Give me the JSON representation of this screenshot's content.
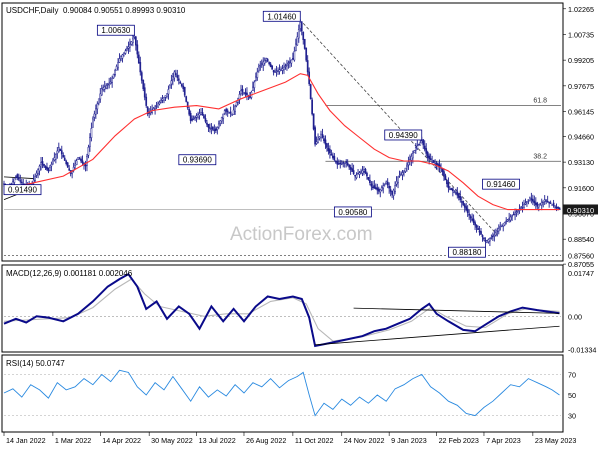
{
  "header": {
    "symbol": "USDCHF,Daily",
    "ohlc": "0.90084 0.90551 0.89993 0.90310"
  },
  "watermark": "ActionForex.com",
  "colors": {
    "candles": "#1f1f8f",
    "ma": "#ff3030",
    "macd": "#0a0a8a",
    "signal": "#b8b8b8",
    "rsi": "#2a8ae0",
    "box_border": "#000080",
    "price_marker_bg": "#1a1a1a",
    "fib": "#707070"
  },
  "chart_data": [
    {
      "type": "candlestick",
      "title": "USDCHF,Daily",
      "ylim": [
        0.873,
        1.0255
      ],
      "y_ticks": [
        "1.02265",
        "1.00735",
        "0.99205",
        "0.97675",
        "0.96145",
        "0.94660",
        "0.93130",
        "0.91600",
        "0.90070",
        "0.88540",
        "0.87055"
      ],
      "x_ticks": [
        "14 Jan 2022",
        "1 Mar 2022",
        "14 Apr 2022",
        "30 May 2022",
        "13 Jul 2022",
        "26 Aug 2022",
        "11 Oct 2022",
        "24 Nov 2022",
        "9 Jan 2023",
        "22 Feb 2023",
        "7 Apr 2023",
        "23 May 2023"
      ],
      "x_tick_index": [
        0,
        33,
        65,
        98,
        130,
        162,
        195,
        228,
        260,
        292,
        324,
        357
      ],
      "current_price": "0.90310",
      "price_series": [
        [
          0,
          0.9185
        ],
        [
          3,
          0.915
        ],
        [
          8,
          0.923
        ],
        [
          12,
          0.919
        ],
        [
          18,
          0.9165
        ],
        [
          25,
          0.931
        ],
        [
          30,
          0.926
        ],
        [
          37,
          0.94
        ],
        [
          45,
          0.9245
        ],
        [
          50,
          0.934
        ],
        [
          55,
          0.929
        ],
        [
          60,
          0.957
        ],
        [
          66,
          0.975
        ],
        [
          72,
          0.979
        ],
        [
          78,
          0.993
        ],
        [
          84,
          1.0
        ],
        [
          88,
          1.0063
        ],
        [
          92,
          0.985
        ],
        [
          97,
          0.96
        ],
        [
          103,
          0.965
        ],
        [
          110,
          0.972
        ],
        [
          115,
          0.985
        ],
        [
          121,
          0.975
        ],
        [
          126,
          0.956
        ],
        [
          133,
          0.961
        ],
        [
          138,
          0.952
        ],
        [
          143,
          0.95
        ],
        [
          149,
          0.962
        ],
        [
          154,
          0.96
        ],
        [
          160,
          0.974
        ],
        [
          166,
          0.97
        ],
        [
          172,
          0.988
        ],
        [
          177,
          0.993
        ],
        [
          182,
          0.985
        ],
        [
          188,
          0.987
        ],
        [
          195,
          0.993
        ],
        [
          200,
          1.0146
        ],
        [
          203,
          0.999
        ],
        [
          206,
          0.978
        ],
        [
          210,
          0.942
        ],
        [
          214,
          0.948
        ],
        [
          219,
          0.938
        ],
        [
          225,
          0.93
        ],
        [
          231,
          0.931
        ],
        [
          237,
          0.923
        ],
        [
          243,
          0.927
        ],
        [
          248,
          0.917
        ],
        [
          253,
          0.914
        ],
        [
          258,
          0.9195
        ],
        [
          262,
          0.912
        ],
        [
          266,
          0.9225
        ],
        [
          270,
          0.926
        ],
        [
          274,
          0.933
        ],
        [
          278,
          0.94
        ],
        [
          282,
          0.944
        ],
        [
          286,
          0.934
        ],
        [
          290,
          0.931
        ],
        [
          295,
          0.928
        ],
        [
          300,
          0.916
        ],
        [
          305,
          0.913
        ],
        [
          310,
          0.906
        ],
        [
          315,
          0.898
        ],
        [
          320,
          0.891
        ],
        [
          325,
          0.884
        ],
        [
          330,
          0.887
        ],
        [
          335,
          0.893
        ],
        [
          340,
          0.897
        ],
        [
          345,
          0.901
        ],
        [
          350,
          0.905
        ],
        [
          355,
          0.91
        ],
        [
          360,
          0.905
        ],
        [
          365,
          0.909
        ],
        [
          370,
          0.906
        ],
        [
          375,
          0.9031
        ]
      ],
      "ma_series": [
        [
          0,
          0.915
        ],
        [
          20,
          0.919
        ],
        [
          40,
          0.923
        ],
        [
          60,
          0.933
        ],
        [
          75,
          0.947
        ],
        [
          88,
          0.957
        ],
        [
          100,
          0.962
        ],
        [
          115,
          0.964
        ],
        [
          130,
          0.965
        ],
        [
          145,
          0.963
        ],
        [
          160,
          0.969
        ],
        [
          175,
          0.974
        ],
        [
          190,
          0.979
        ],
        [
          200,
          0.984
        ],
        [
          205,
          0.983
        ],
        [
          212,
          0.972
        ],
        [
          220,
          0.962
        ],
        [
          230,
          0.953
        ],
        [
          240,
          0.946
        ],
        [
          250,
          0.939
        ],
        [
          260,
          0.934
        ],
        [
          270,
          0.932
        ],
        [
          280,
          0.932
        ],
        [
          290,
          0.93
        ],
        [
          300,
          0.926
        ],
        [
          310,
          0.919
        ],
        [
          320,
          0.911
        ],
        [
          330,
          0.906
        ],
        [
          340,
          0.903
        ],
        [
          350,
          0.903
        ],
        [
          360,
          0.903
        ],
        [
          375,
          0.903
        ]
      ],
      "labels": [
        {
          "text": "1.00630",
          "x": 88,
          "y": 1.0063,
          "anchor": "above-left"
        },
        {
          "text": "1.01460",
          "x": 200,
          "y": 1.0146,
          "anchor": "above-left"
        },
        {
          "text": "0.93690",
          "x": 143,
          "y": 0.9369,
          "anchor": "below-left"
        },
        {
          "text": "0.94390",
          "x": 282,
          "y": 0.9439,
          "anchor": "above-left"
        },
        {
          "text": "0.90580",
          "x": 248,
          "y": 0.9058,
          "anchor": "below-left"
        },
        {
          "text": "0.91460",
          "x": 348,
          "y": 0.9146,
          "anchor": "above-left"
        },
        {
          "text": "0.88180",
          "x": 325,
          "y": 0.8818,
          "anchor": "below-left"
        },
        {
          "text": "0.91490",
          "x": 0,
          "y": 0.9149,
          "anchor": "level-left"
        }
      ],
      "annotations": [
        {
          "text": "61.8",
          "level": 0.965
        },
        {
          "text": "38.2",
          "level": 0.9318
        }
      ],
      "support_level": 0.8756,
      "support_label": "0.87560"
    },
    {
      "type": "line",
      "title": "MACD(12,26,9) 0.001181 0.002046",
      "ylim": [
        -0.014,
        0.0195
      ],
      "y_ticks": [
        "0.01747",
        "0.00",
        "-0.01334"
      ],
      "macd_series": [
        [
          0,
          -0.003
        ],
        [
          8,
          -0.001
        ],
        [
          15,
          -0.0025
        ],
        [
          22,
          0.0
        ],
        [
          30,
          -0.0005
        ],
        [
          40,
          -0.002
        ],
        [
          50,
          0.001
        ],
        [
          60,
          0.006
        ],
        [
          70,
          0.012
        ],
        [
          78,
          0.015
        ],
        [
          84,
          0.017
        ],
        [
          90,
          0.012
        ],
        [
          96,
          0.003
        ],
        [
          103,
          0.006
        ],
        [
          110,
          -0.001
        ],
        [
          118,
          0.004
        ],
        [
          125,
          0.001
        ],
        [
          132,
          -0.005
        ],
        [
          140,
          0.004
        ],
        [
          148,
          -0.002
        ],
        [
          155,
          0.003
        ],
        [
          162,
          -0.002
        ],
        [
          170,
          0.004
        ],
        [
          178,
          0.008
        ],
        [
          186,
          0.007
        ],
        [
          195,
          0.008
        ],
        [
          201,
          0.007
        ],
        [
          206,
          -0.0005
        ],
        [
          210,
          -0.012
        ],
        [
          218,
          -0.011
        ],
        [
          226,
          -0.01
        ],
        [
          234,
          -0.009
        ],
        [
          242,
          -0.008
        ],
        [
          250,
          -0.006
        ],
        [
          258,
          -0.005
        ],
        [
          266,
          -0.003
        ],
        [
          274,
          -0.001
        ],
        [
          282,
          0.003
        ],
        [
          287,
          0.005
        ],
        [
          292,
          0.001
        ],
        [
          300,
          -0.002
        ],
        [
          310,
          -0.0055
        ],
        [
          318,
          -0.006
        ],
        [
          326,
          -0.003
        ],
        [
          334,
          0.0
        ],
        [
          342,
          0.002
        ],
        [
          350,
          0.0035
        ],
        [
          360,
          0.0025
        ],
        [
          366,
          0.002
        ],
        [
          375,
          0.0012
        ]
      ],
      "signal_series": [
        [
          0,
          -0.002
        ],
        [
          15,
          -0.0015
        ],
        [
          30,
          -0.001
        ],
        [
          45,
          -0.0005
        ],
        [
          60,
          0.0035
        ],
        [
          75,
          0.011
        ],
        [
          86,
          0.015
        ],
        [
          95,
          0.009
        ],
        [
          105,
          0.004
        ],
        [
          120,
          0.002
        ],
        [
          135,
          0.0
        ],
        [
          150,
          0.001
        ],
        [
          165,
          0.001
        ],
        [
          180,
          0.006
        ],
        [
          195,
          0.0075
        ],
        [
          204,
          0.005
        ],
        [
          212,
          -0.005
        ],
        [
          222,
          -0.01
        ],
        [
          240,
          -0.0085
        ],
        [
          260,
          -0.0055
        ],
        [
          275,
          -0.002
        ],
        [
          288,
          0.0035
        ],
        [
          298,
          0.0
        ],
        [
          312,
          -0.004
        ],
        [
          325,
          -0.0045
        ],
        [
          340,
          0.001
        ],
        [
          352,
          0.003
        ],
        [
          365,
          0.0024
        ],
        [
          375,
          0.002
        ]
      ],
      "trendlines": [
        {
          "from": [
            236,
            0.0033
          ],
          "to": [
            375,
            0.0012
          ]
        },
        {
          "from": [
            210,
            -0.0115
          ],
          "to": [
            375,
            -0.004
          ]
        }
      ]
    },
    {
      "type": "line",
      "title": "RSI(14) 50.0747",
      "ylim": [
        15,
        86
      ],
      "y_ticks": [
        "70",
        "50",
        "30"
      ],
      "rsi_series": [
        [
          0,
          52
        ],
        [
          6,
          56
        ],
        [
          12,
          48
        ],
        [
          18,
          60
        ],
        [
          24,
          55
        ],
        [
          30,
          47
        ],
        [
          36,
          62
        ],
        [
          42,
          55
        ],
        [
          48,
          58
        ],
        [
          54,
          66
        ],
        [
          60,
          60
        ],
        [
          66,
          70
        ],
        [
          72,
          63
        ],
        [
          78,
          74
        ],
        [
          84,
          72
        ],
        [
          90,
          58
        ],
        [
          96,
          50
        ],
        [
          102,
          62
        ],
        [
          108,
          55
        ],
        [
          114,
          68
        ],
        [
          120,
          56
        ],
        [
          126,
          44
        ],
        [
          132,
          58
        ],
        [
          138,
          48
        ],
        [
          144,
          55
        ],
        [
          150,
          49
        ],
        [
          156,
          60
        ],
        [
          162,
          52
        ],
        [
          168,
          62
        ],
        [
          174,
          58
        ],
        [
          180,
          66
        ],
        [
          186,
          57
        ],
        [
          192,
          64
        ],
        [
          198,
          68
        ],
        [
          202,
          72
        ],
        [
          206,
          50
        ],
        [
          210,
          30
        ],
        [
          216,
          42
        ],
        [
          222,
          36
        ],
        [
          228,
          46
        ],
        [
          234,
          40
        ],
        [
          240,
          48
        ],
        [
          246,
          42
        ],
        [
          252,
          50
        ],
        [
          258,
          44
        ],
        [
          264,
          56
        ],
        [
          270,
          60
        ],
        [
          276,
          66
        ],
        [
          282,
          70
        ],
        [
          288,
          58
        ],
        [
          294,
          52
        ],
        [
          300,
          44
        ],
        [
          306,
          40
        ],
        [
          312,
          32
        ],
        [
          318,
          30
        ],
        [
          324,
          38
        ],
        [
          330,
          44
        ],
        [
          336,
          52
        ],
        [
          342,
          60
        ],
        [
          348,
          58
        ],
        [
          354,
          66
        ],
        [
          360,
          62
        ],
        [
          366,
          58
        ],
        [
          370,
          55
        ],
        [
          375,
          50
        ]
      ]
    }
  ]
}
